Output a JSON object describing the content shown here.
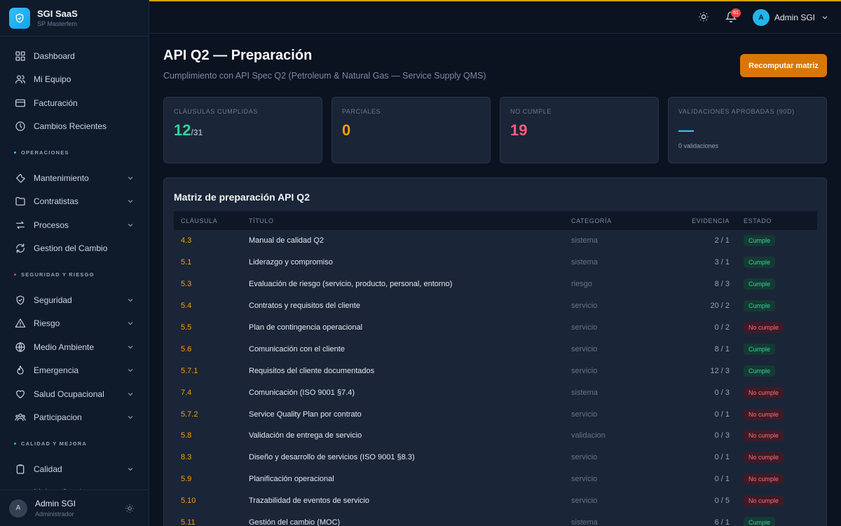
{
  "brand": {
    "name": "SGI SaaS",
    "subtitle": "SP Masterfem"
  },
  "sidebar": {
    "main_items": [
      {
        "label": "Dashboard",
        "icon": "grid-icon"
      },
      {
        "label": "Mi Equipo",
        "icon": "users-icon"
      },
      {
        "label": "Facturación",
        "icon": "card-icon"
      },
      {
        "label": "Cambios Recientes",
        "icon": "clock-icon"
      }
    ],
    "sections": [
      {
        "title": "OPERACIONES",
        "dot_color": "#38bdf8",
        "items": [
          {
            "label": "Mantenimiento",
            "icon": "wrench-icon",
            "expandable": true
          },
          {
            "label": "Contratistas",
            "icon": "folder-icon",
            "expandable": true
          },
          {
            "label": "Procesos",
            "icon": "arrows-icon",
            "expandable": true
          },
          {
            "label": "Gestion del Cambio",
            "icon": "refresh-icon",
            "expandable": false
          }
        ]
      },
      {
        "title": "SEGURIDAD Y RIESGO",
        "dot_color": "#ef4444",
        "items": [
          {
            "label": "Seguridad",
            "icon": "shield-icon",
            "expandable": true
          },
          {
            "label": "Riesgo",
            "icon": "warning-icon",
            "expandable": true
          },
          {
            "label": "Medio Ambiente",
            "icon": "globe-icon",
            "expandable": true
          },
          {
            "label": "Emergencia",
            "icon": "flame-icon",
            "expandable": true
          },
          {
            "label": "Salud Ocupacional",
            "icon": "heart-icon",
            "expandable": true
          },
          {
            "label": "Participacion",
            "icon": "group-icon",
            "expandable": true
          }
        ]
      },
      {
        "title": "CALIDAD Y MEJORA",
        "dot_color": "#22c55e",
        "items": [
          {
            "label": "Calidad",
            "icon": "clipboard-icon",
            "expandable": true
          },
          {
            "label": "Mejora Continua",
            "icon": "trend-icon",
            "expandable": true
          }
        ]
      }
    ],
    "user": {
      "initial": "A",
      "name": "Admin SGI",
      "role": "Administrador"
    }
  },
  "topbar": {
    "notification_count": "61",
    "user_initial": "A",
    "user_name": "Admin SGI"
  },
  "page": {
    "title": "API Q2 — Preparación",
    "subtitle": "Cumplimiento con API Spec Q2 (Petroleum & Natural Gas — Service Supply QMS)",
    "primary_button": "Recomputar matriz"
  },
  "stats": {
    "cumplidas": {
      "label": "CLÁUSULAS CUMPLIDAS",
      "value": "12",
      "total": "/31",
      "color": "#34d399"
    },
    "parciales": {
      "label": "PARCIALES",
      "value": "0",
      "color": "#f59e0b"
    },
    "no_cumple": {
      "label": "NO CUMPLE",
      "value": "19",
      "color": "#fb5d7d"
    },
    "validaciones": {
      "label": "VALIDACIONES APROBADAS (90D)",
      "value": "—",
      "note": "0 validaciones",
      "color": "#38bdf8"
    }
  },
  "matrix": {
    "title": "Matriz de preparación API Q2",
    "columns": {
      "clausula": "CLÁUSULA",
      "titulo": "TÍTULO",
      "categoria": "CATEGORÍA",
      "evidencia": "EVIDENCIA",
      "estado": "ESTADO"
    },
    "rows": [
      {
        "clausula": "4.3",
        "titulo": "Manual de calidad Q2",
        "categoria": "sistema",
        "evidencia": "2 / 1",
        "estado": "Cumple",
        "ok": true
      },
      {
        "clausula": "5.1",
        "titulo": "Liderazgo y compromiso",
        "categoria": "sistema",
        "evidencia": "3 / 1",
        "estado": "Cumple",
        "ok": true
      },
      {
        "clausula": "5.3",
        "titulo": "Evaluación de riesgo (servicio, producto, personal, entorno)",
        "categoria": "riesgo",
        "evidencia": "8 / 3",
        "estado": "Cumple",
        "ok": true
      },
      {
        "clausula": "5.4",
        "titulo": "Contratos y requisitos del cliente",
        "categoria": "servicio",
        "evidencia": "20 / 2",
        "estado": "Cumple",
        "ok": true
      },
      {
        "clausula": "5.5",
        "titulo": "Plan de contingencia operacional",
        "categoria": "servicio",
        "evidencia": "0 / 2",
        "estado": "No cumple",
        "ok": false
      },
      {
        "clausula": "5.6",
        "titulo": "Comunicación con el cliente",
        "categoria": "servicio",
        "evidencia": "8 / 1",
        "estado": "Cumple",
        "ok": true
      },
      {
        "clausula": "5.7.1",
        "titulo": "Requisitos del cliente documentados",
        "categoria": "servicio",
        "evidencia": "12 / 3",
        "estado": "Cumple",
        "ok": true
      },
      {
        "clausula": "7.4",
        "titulo": "Comunicación (ISO 9001 §7.4)",
        "categoria": "sistema",
        "evidencia": "0 / 3",
        "estado": "No cumple",
        "ok": false
      },
      {
        "clausula": "5.7.2",
        "titulo": "Service Quality Plan por contrato",
        "categoria": "servicio",
        "evidencia": "0 / 1",
        "estado": "No cumple",
        "ok": false
      },
      {
        "clausula": "5.8",
        "titulo": "Validación de entrega de servicio",
        "categoria": "validacion",
        "evidencia": "0 / 3",
        "estado": "No cumple",
        "ok": false
      },
      {
        "clausula": "8.3",
        "titulo": "Diseño y desarrollo de servicios (ISO 9001 §8.3)",
        "categoria": "servicio",
        "evidencia": "0 / 1",
        "estado": "No cumple",
        "ok": false
      },
      {
        "clausula": "5.9",
        "titulo": "Planificación operacional",
        "categoria": "servicio",
        "evidencia": "0 / 1",
        "estado": "No cumple",
        "ok": false
      },
      {
        "clausula": "5.10",
        "titulo": "Trazabilidad de eventos de servicio",
        "categoria": "servicio",
        "evidencia": "0 / 5",
        "estado": "No cumple",
        "ok": false
      },
      {
        "clausula": "5.11",
        "titulo": "Gestión del cambio (MOC)",
        "categoria": "sistema",
        "evidencia": "6 / 1",
        "estado": "Cumple",
        "ok": true
      }
    ]
  }
}
